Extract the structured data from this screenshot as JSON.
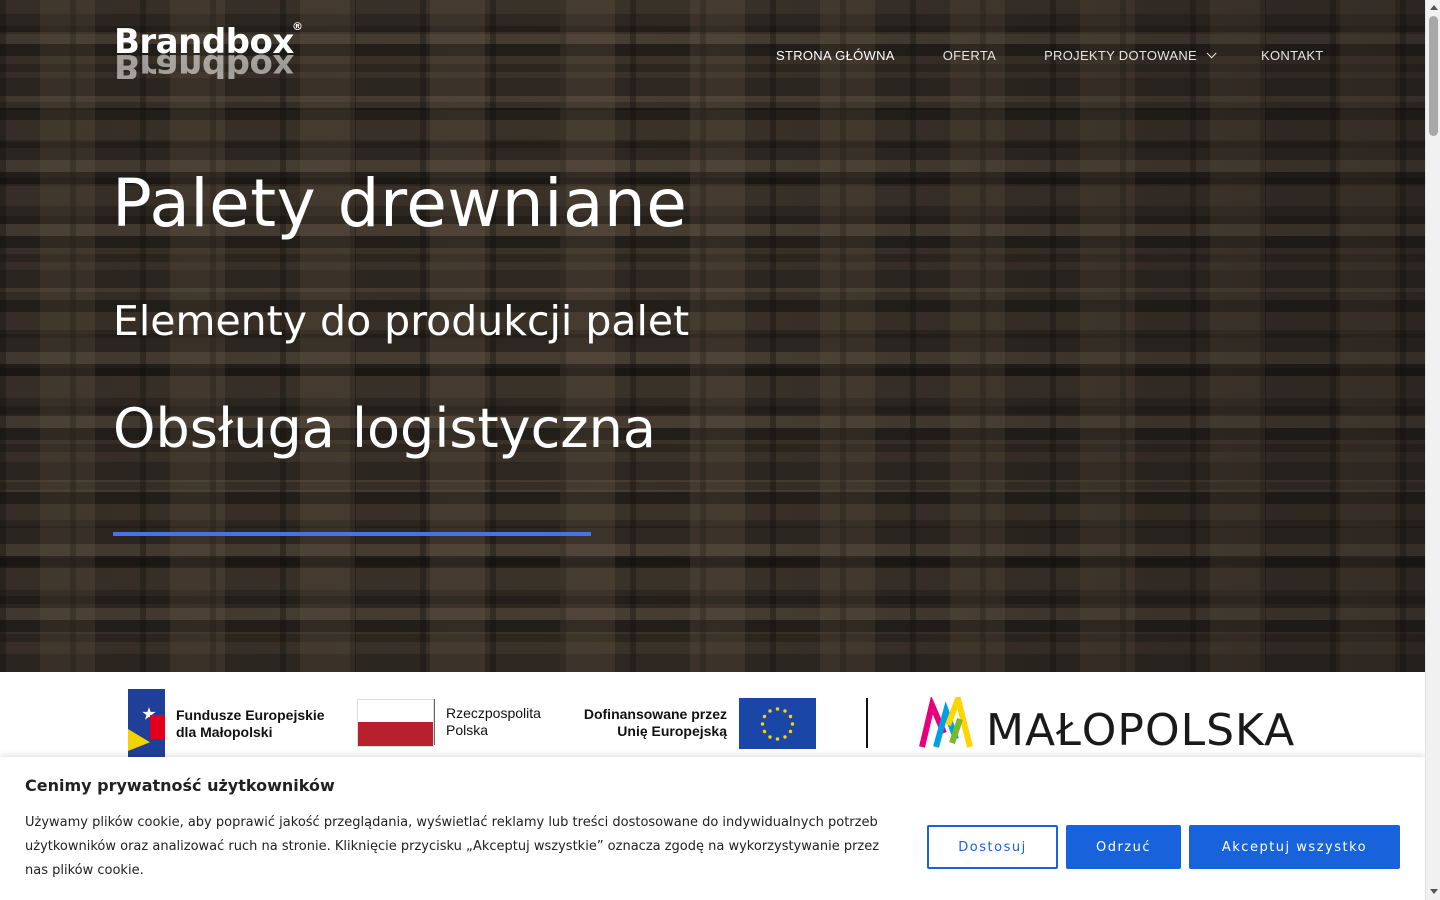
{
  "header": {
    "logo": "Brandbox",
    "logo_reg": "®",
    "nav": [
      {
        "label": "STRONA GŁÓWNA",
        "active": true
      },
      {
        "label": "OFERTA"
      },
      {
        "label": "PROJEKTY DOTOWANE",
        "has_dropdown": true
      },
      {
        "label": "KONTAKT"
      }
    ]
  },
  "hero": {
    "line1": "Palety drewniane",
    "line2": "Elementy do produkcji palet",
    "line3": "Obsługa logistyczna",
    "accent_color": "#4a72e4"
  },
  "funds": {
    "fe_line1": "Fundusze Europejskie",
    "fe_line2": "dla Małopolski",
    "pl_line1": "Rzeczpospolita",
    "pl_line2": "Polska",
    "eu_line1": "Dofinansowane przez",
    "eu_line2": "Unię Europejską",
    "region": "MAŁOPOLSKA"
  },
  "cookie": {
    "title": "Cenimy prywatność użytkowników",
    "text": "Używamy plików cookie, aby poprawić jakość przeglądania, wyświetlać reklamy lub treści dostosowane do indywidualnych potrzeb użytkowników oraz analizować ruch na stronie. Kliknięcie przycisku „Akceptuj wszystkie” oznacza zgodę na wykorzystywanie przez nas plików cookie.",
    "btn_customize": "Dostosuj",
    "btn_reject": "Odrzuć",
    "btn_accept": "Akceptuj wszystko",
    "button_color": "#1863dc"
  }
}
